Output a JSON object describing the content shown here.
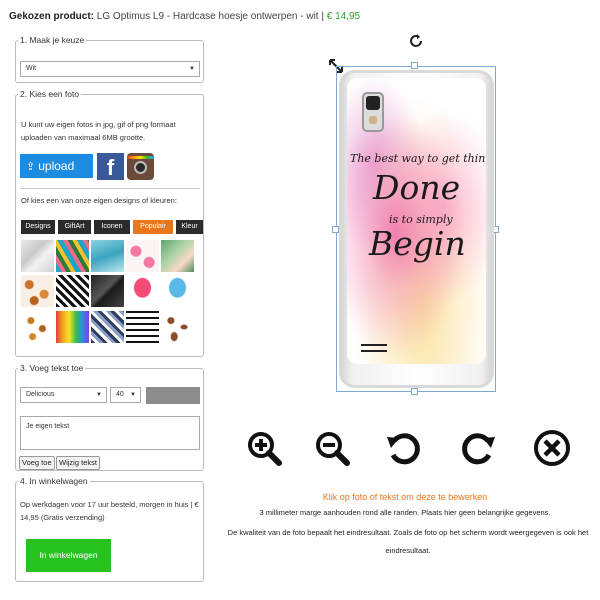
{
  "header": {
    "label": "Gekozen product:",
    "product_name": "LG Optimus L9 - Hardcase hoesje ontwerpen - wit",
    "separator": "|",
    "price": "€ 14,95"
  },
  "step1": {
    "title": "1. Maak je keuze",
    "select_value": "Wit"
  },
  "step2": {
    "title": "2. Kies een foto",
    "description": "U kunt uw eigen fotos in jpg, gif of png formaat uploaden van maximaal 6MB grootte.",
    "upload_label": "upload",
    "facebook_glyph": "f",
    "designs_text": "Of kies een van onze eigen designs of kleuren:",
    "tabs": [
      "Designs",
      "GiftArt",
      "Iconen",
      "Populair",
      "Kleur"
    ],
    "active_tab": "Populair"
  },
  "step3": {
    "title": "3. Voeg tekst toe",
    "font_value": "Delicious",
    "size_value": "40",
    "textarea_placeholder": "Je eigen tekst",
    "add_button": "Voeg toe",
    "edit_button": "Wijzig tekst"
  },
  "step4": {
    "title": "4. In winkelwagen",
    "info": "Op werkdagen voor 17 uur besteld, morgen in huis | € 14,95 (Gratis verzending)",
    "cart_button": "In winkelwagen"
  },
  "case_design": {
    "line1": "The best way to get things",
    "line2": "Done",
    "line3": "is to simply",
    "line4": "Begin"
  },
  "instructions": {
    "click_hint": "Klik op foto of tekst om deze te bewerken",
    "margin_note": "3 millimeter marge aanhouden rond alle randen. Plaats hier geen belangrijke gegevens.",
    "quality_note": "De kwaliteit van de foto bepaalt het eindresultaat. Zoals de foto op het scherm wordt weergegeven is ook het eindresultaat."
  },
  "colors": {
    "accent_orange": "#e8761a",
    "price_green": "#2e9e2e",
    "cart_green": "#28c21f",
    "upload_blue": "#1c8ce3",
    "facebook_blue": "#3b5998"
  }
}
